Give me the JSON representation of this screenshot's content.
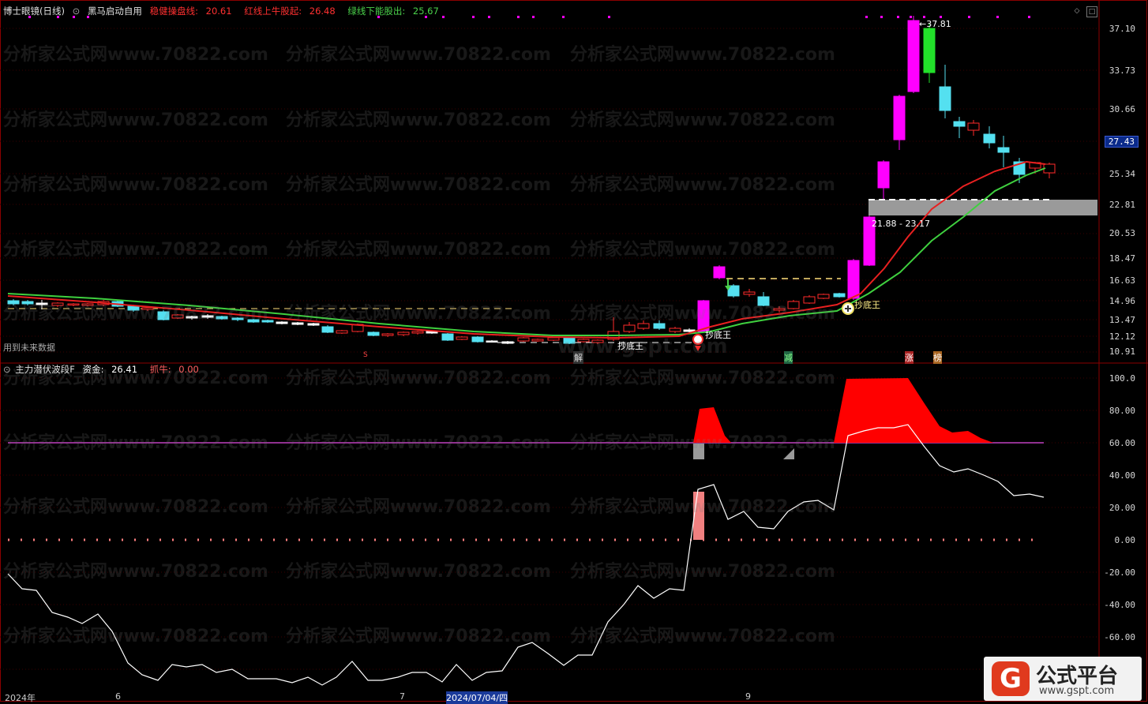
{
  "panel_top": {
    "title": "博士眼镜(日线)",
    "indicator_name": "黑马启动自用",
    "items": [
      {
        "label": "稳健操盘线:",
        "value": "20.61",
        "color": "#ff3030"
      },
      {
        "label": "红线上牛股起:",
        "value": "26.48",
        "color": "#ff3030"
      },
      {
        "label": "绿线下能股出:",
        "value": "25.67",
        "color": "#4bd24b"
      }
    ],
    "future_data_note": "用到未来数据",
    "price_axis": [
      "37.10",
      "33.73",
      "30.66",
      "27.43",
      "25.34",
      "22.81",
      "20.53",
      "18.47",
      "16.63",
      "14.96",
      "13.47",
      "12.12",
      "10.91"
    ],
    "current_price": "27.43",
    "high_label": "37.81",
    "zone_label": "21.88 - 23.17",
    "signal_labels": [
      "抄底王",
      "抄底王",
      "抄底王"
    ],
    "marker_labels": [
      "解",
      "减",
      "涨",
      "榜",
      "S"
    ]
  },
  "panel_bottom": {
    "indicator_name": "主力潜伏波段F",
    "items": [
      {
        "label": "资金:",
        "value": "26.41",
        "color": "#ffffff"
      },
      {
        "label": "抓牛:",
        "value": "0.00",
        "color": "#ff6060"
      }
    ],
    "value_axis": [
      "100.0",
      "80.00",
      "60.00",
      "40.00",
      "20.00",
      "0.00",
      "-20.00",
      "-40.00",
      "-60.00"
    ]
  },
  "time_axis": [
    "2024年",
    "6",
    "7",
    "2024/07/04/四",
    "9"
  ],
  "watermark_text": "分析家公式网www.70822.com",
  "watermark_text2": "www.gspt.com",
  "logo": {
    "glyph": "G",
    "title": "公式平台",
    "url": "www.gspt.com"
  },
  "colors": {
    "up_candle": "#ff2a2a",
    "down_candle": "#54e0f0",
    "magenta": "#ff00ff",
    "red_line": "#e82020",
    "green_line": "#3fd03f",
    "fund_line": "#ffffff",
    "fill_red": "#ff0000"
  }
}
